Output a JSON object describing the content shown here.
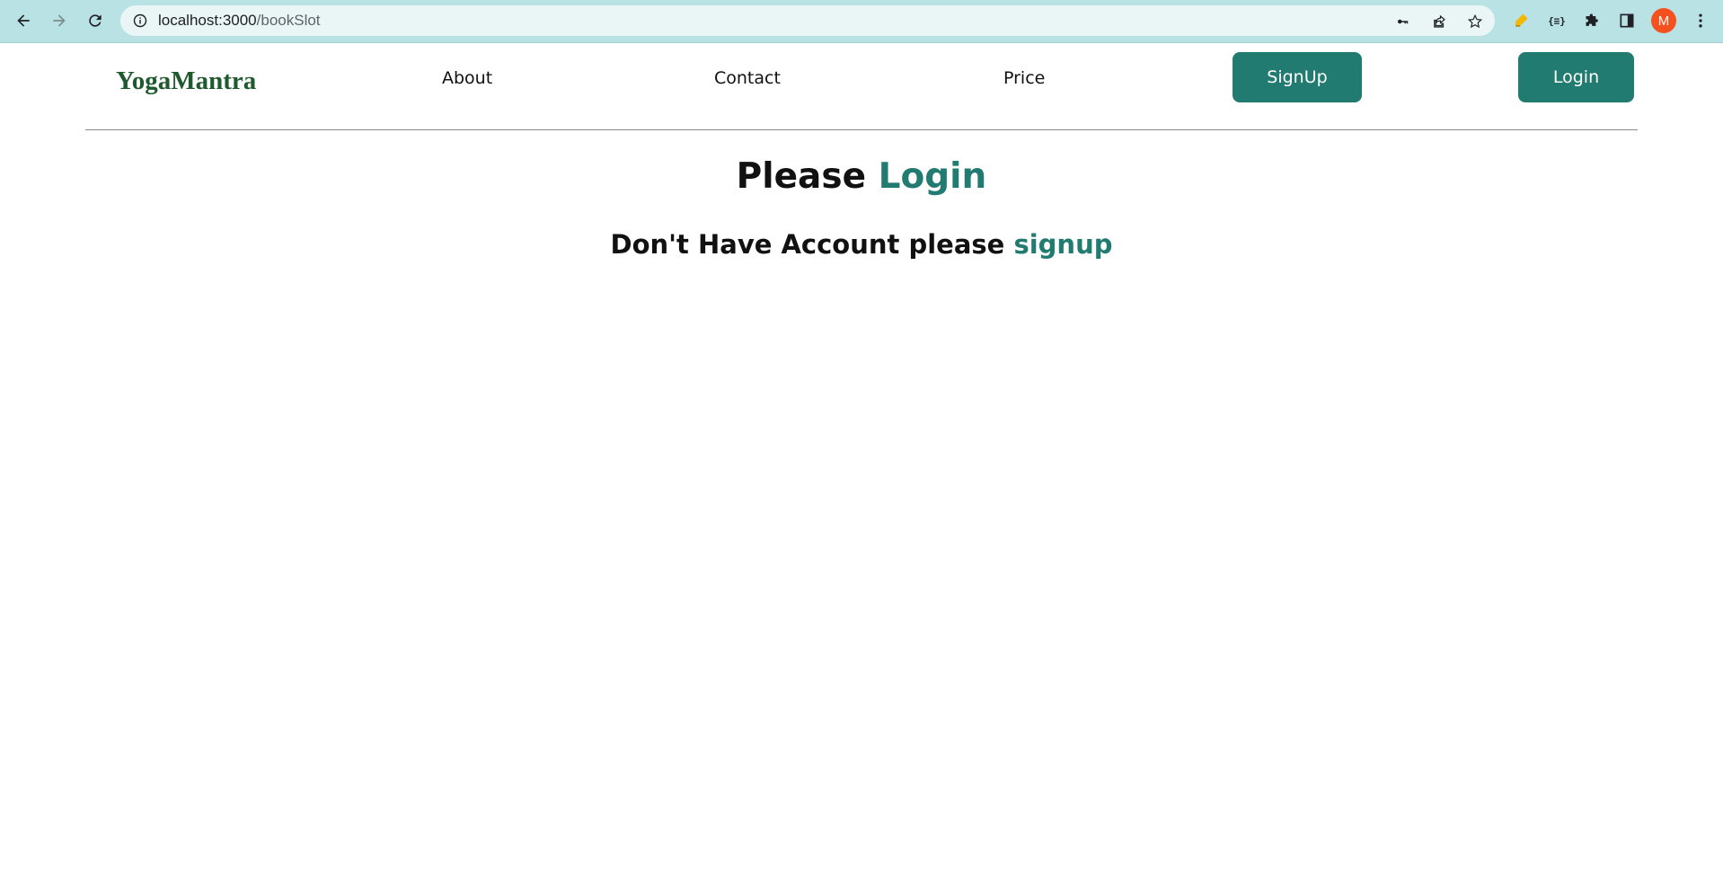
{
  "browser": {
    "url_host": "localhost:3000",
    "url_path": "/bookSlot",
    "avatar_letter": "M"
  },
  "nav": {
    "brand": "YogaMantra",
    "links": [
      "About",
      "Contact",
      "Price"
    ],
    "signup_label": "SignUp",
    "login_label": "Login"
  },
  "main": {
    "heading_prefix": "Please",
    "heading_link": "Login",
    "subheading_prefix": "Don't Have Account please",
    "subheading_link": "signup"
  },
  "colors": {
    "accent": "#227b70",
    "brand": "#1e5a2e",
    "browser_frame": "#b8e2e4",
    "avatar": "#f4511e"
  }
}
